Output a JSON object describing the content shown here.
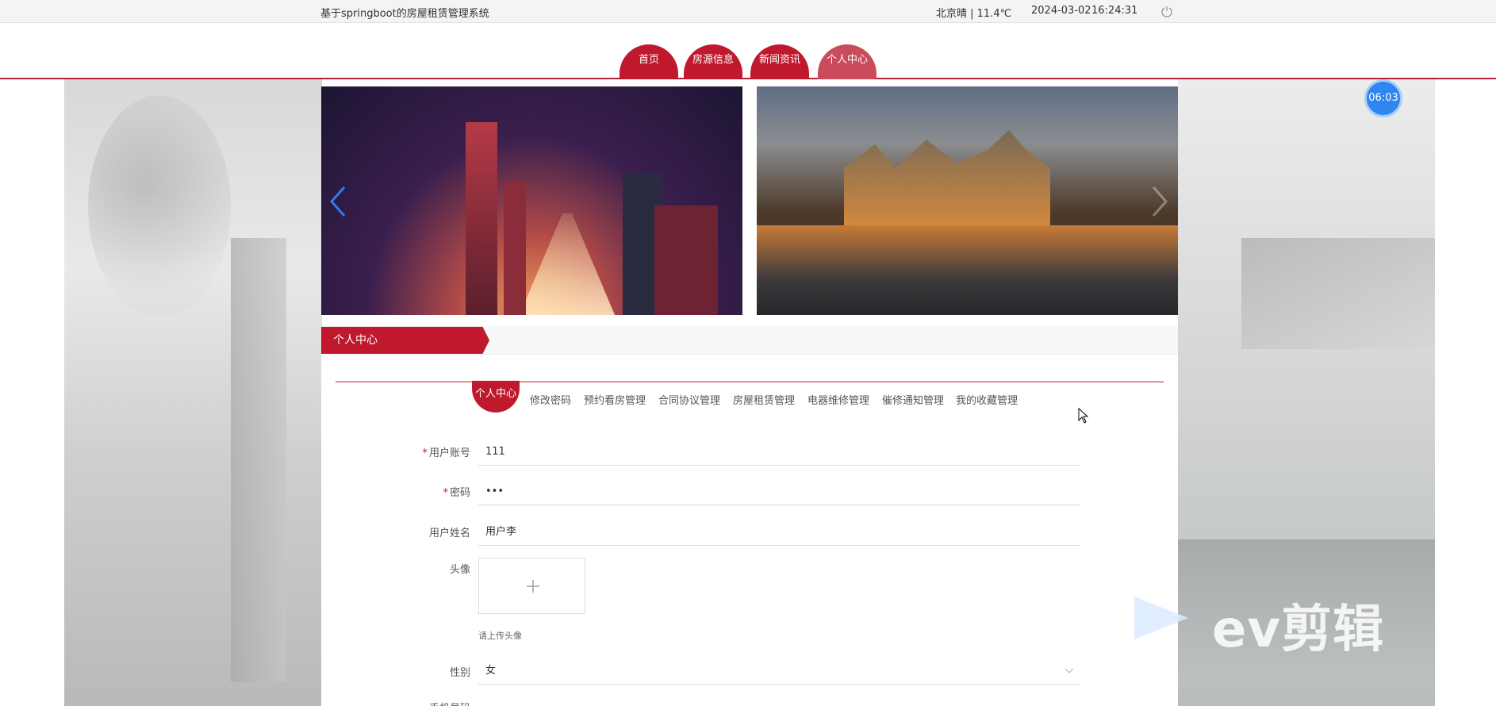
{
  "topbar": {
    "title": "基于springboot的房屋租赁管理系统",
    "weather": "北京晴 | 11.4℃",
    "date": "2024-03-02",
    "time": "16:24:31",
    "power_icon": "power-icon"
  },
  "nav": {
    "items": [
      {
        "label": "首页",
        "active": false
      },
      {
        "label": "房源信息",
        "active": false
      },
      {
        "label": "新闻资讯",
        "active": false
      },
      {
        "label": "个人中心",
        "active": true
      }
    ]
  },
  "carousel": {
    "slides": [
      "city-night-image",
      "canal-castle-image"
    ],
    "prev_icon": "chevron-left-icon",
    "next_icon": "chevron-right-icon"
  },
  "timer": {
    "value": "06:03"
  },
  "panel": {
    "title": "个人中心",
    "tabs": [
      {
        "label": "个人中心",
        "active": true
      },
      {
        "label": "修改密码",
        "active": false
      },
      {
        "label": "预约看房管理",
        "active": false
      },
      {
        "label": "合同协议管理",
        "active": false
      },
      {
        "label": "房屋租赁管理",
        "active": false
      },
      {
        "label": "电器维修管理",
        "active": false
      },
      {
        "label": "催修通知管理",
        "active": false
      },
      {
        "label": "我的收藏管理",
        "active": false
      }
    ]
  },
  "form": {
    "account_label": "用户账号",
    "account_value": "111",
    "password_label": "密码",
    "password_value": "•••",
    "name_label": "用户姓名",
    "name_value": "用户李",
    "avatar_label": "头像",
    "avatar_hint": "请上传头像",
    "gender_label": "性别",
    "gender_value": "女",
    "phone_label": "手机号码"
  },
  "watermark": {
    "text": "ev剪辑"
  },
  "colors": {
    "brand": "#c0192e",
    "timer": "#2e86f0"
  }
}
